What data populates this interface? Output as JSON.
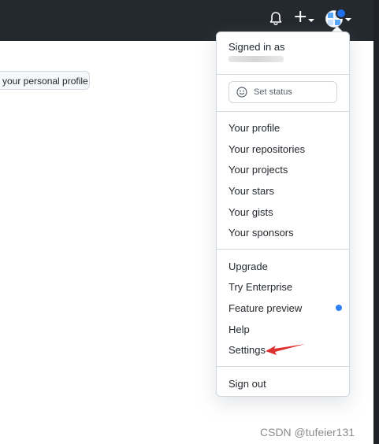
{
  "header": {
    "notifications_icon": "bell-icon",
    "create_icon": "plus-icon",
    "avatar_icon": "avatar-icon",
    "background_color": "#24292f"
  },
  "profile_button": {
    "label": "your personal profile"
  },
  "user_menu": {
    "signed_in_label": "Signed in as",
    "status": {
      "label": "Set status",
      "icon": "smiley-icon"
    },
    "section_profile": [
      {
        "label": "Your profile"
      },
      {
        "label": "Your repositories"
      },
      {
        "label": "Your projects"
      },
      {
        "label": "Your stars"
      },
      {
        "label": "Your gists"
      },
      {
        "label": "Your sponsors"
      }
    ],
    "section_misc": [
      {
        "label": "Upgrade"
      },
      {
        "label": "Try Enterprise"
      },
      {
        "label": "Feature preview"
      },
      {
        "label": "Help"
      },
      {
        "label": "Settings"
      }
    ],
    "sign_out_label": "Sign out",
    "feature_preview_dot_color": "#2f81f7"
  },
  "annotation": {
    "arrow_color": "#e03131"
  },
  "watermark": "CSDN @tufeier131"
}
